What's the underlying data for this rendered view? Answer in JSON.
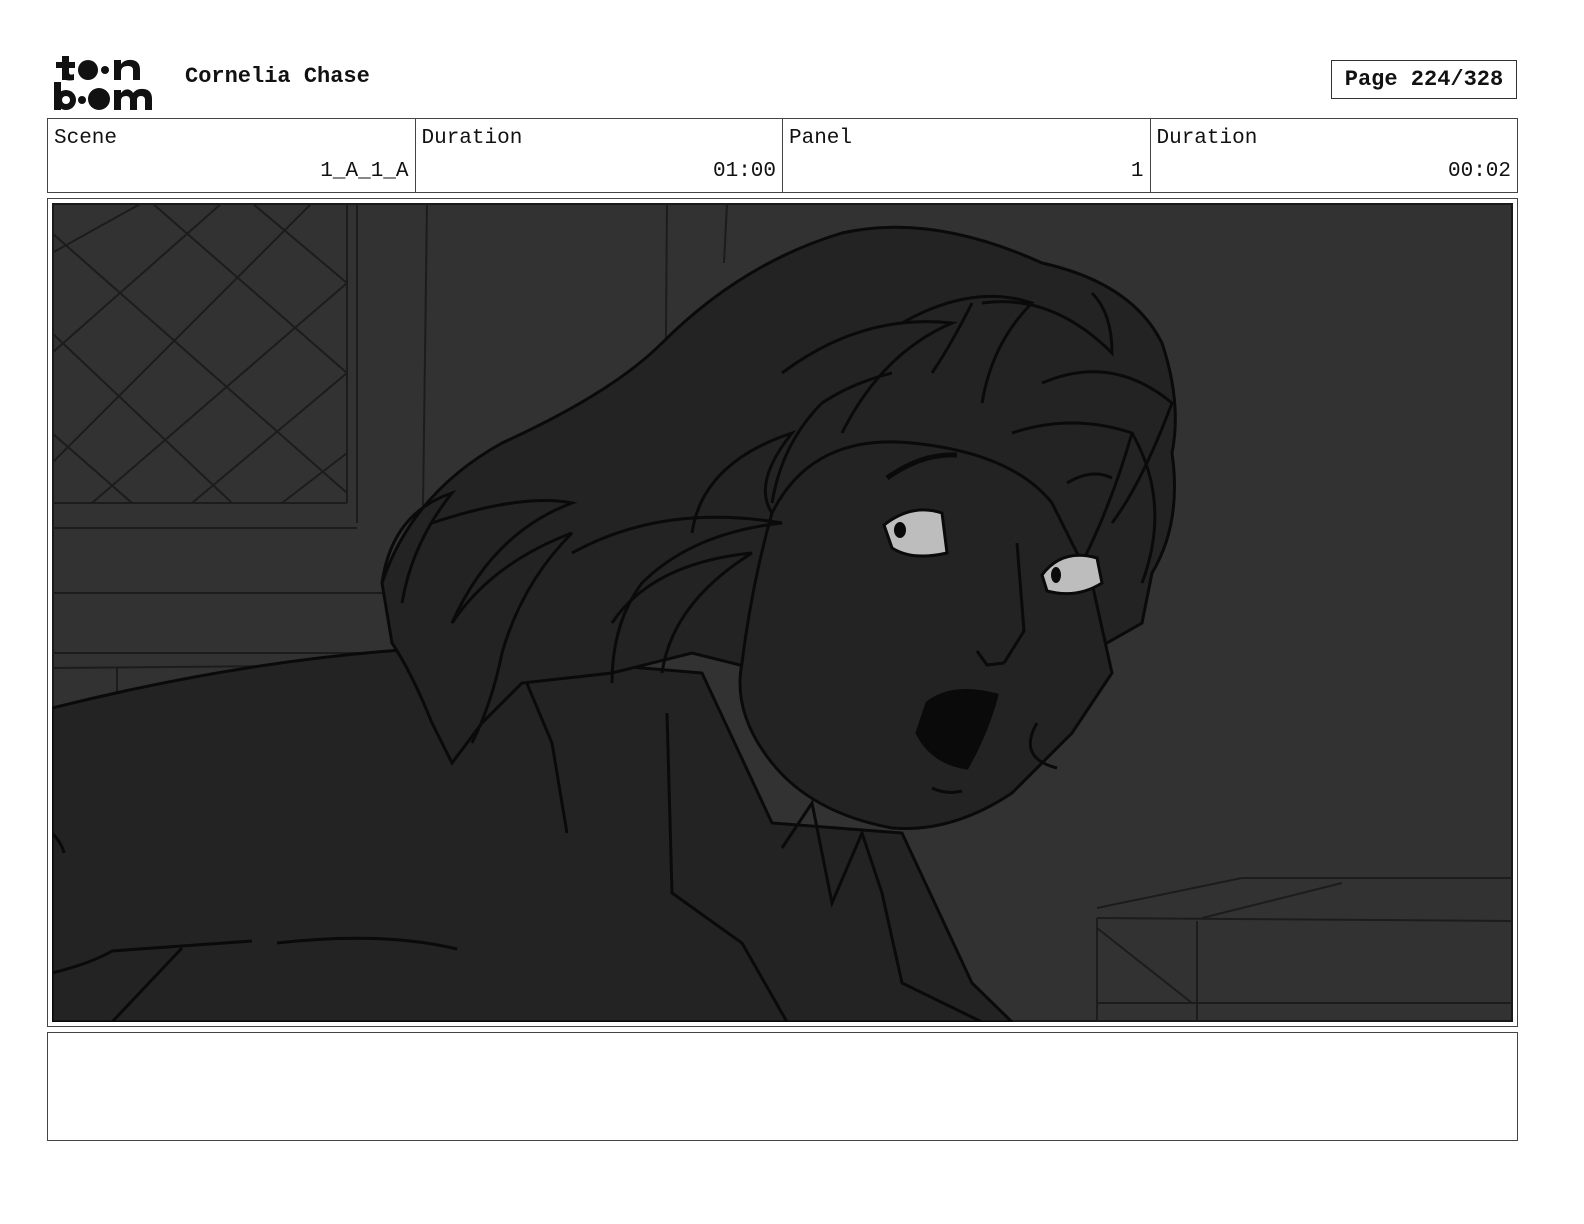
{
  "header": {
    "project_title": "Cornelia Chase",
    "page_label": "Page 224/328",
    "logo": {
      "icon": "toon-boom-logo",
      "text": "toon boom"
    }
  },
  "info": [
    {
      "label": "Scene",
      "value": "1_A_1_A"
    },
    {
      "label": "Duration",
      "value": "01:00"
    },
    {
      "label": "Panel",
      "value": "1"
    },
    {
      "label": "Duration",
      "value": "00:02"
    }
  ],
  "panel": {
    "image_icon": "storyboard-panel-drawing",
    "colors": {
      "background": "#323232",
      "figure": "#232323",
      "line": "#0a0a0a",
      "eye": "#bdbdbd"
    }
  },
  "notes": {
    "text": ""
  }
}
